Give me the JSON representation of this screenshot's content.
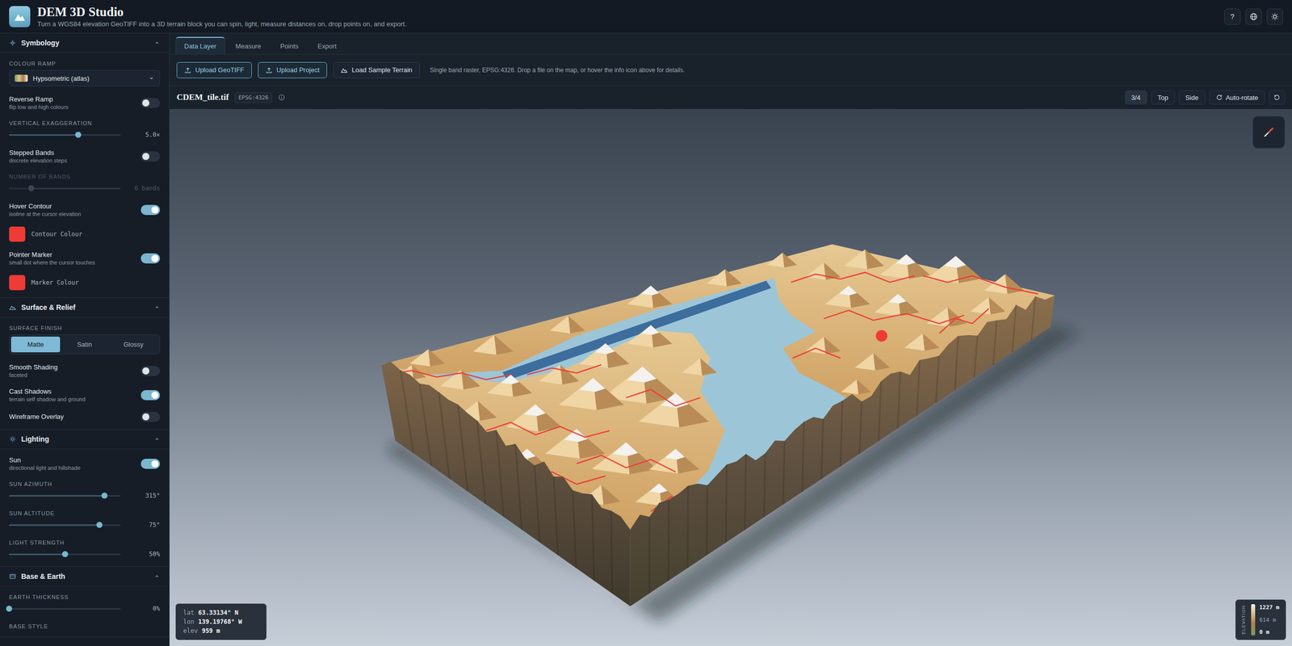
{
  "header": {
    "title": "DEM 3D Studio",
    "subtitle": "Turn a WGS84 elevation GeoTIFF into a 3D terrain block you can spin, light, measure distances on, drop points on, and export.",
    "help": "?"
  },
  "sidebar": {
    "sections": [
      {
        "title": "Symbology",
        "expanded": true,
        "controls": [
          {
            "kind": "select",
            "label": "COLOUR RAMP",
            "value": "Hypsometric (atlas)"
          },
          {
            "kind": "toggle",
            "label": "Reverse Ramp",
            "hint": "flip low and high colours",
            "on": false
          },
          {
            "kind": "slider",
            "label": "VERTICAL EXAGGERATION",
            "level": 0.62,
            "reading": "5.0×",
            "disabled": false
          },
          {
            "kind": "toggle",
            "label": "Stepped Bands",
            "hint": "discrete elevation steps",
            "on": false
          },
          {
            "kind": "slider",
            "label": "NUMBER OF BANDS",
            "level": 0.2,
            "reading": "6 bands",
            "disabled": true
          },
          {
            "kind": "toggle",
            "label": "Hover Contour",
            "hint": "isoline at the cursor elevation",
            "on": true
          },
          {
            "kind": "color",
            "label": "Contour Colour",
            "color": "#ef3b35"
          },
          {
            "kind": "toggle",
            "label": "Pointer Marker",
            "hint": "small dot where the cursor touches",
            "on": true
          },
          {
            "kind": "color",
            "label": "Marker Colour",
            "color": "#ef3b35"
          }
        ]
      },
      {
        "title": "Surface & Relief",
        "expanded": true,
        "controls": [
          {
            "kind": "segmented",
            "label": "SURFACE FINISH",
            "options": [
              {
                "label": "Matte",
                "selected": true
              },
              {
                "label": "Satin",
                "selected": false
              },
              {
                "label": "Glossy",
                "selected": false
              }
            ]
          },
          {
            "kind": "toggle",
            "label": "Smooth Shading",
            "hint": "faceted",
            "on": false
          },
          {
            "kind": "toggle",
            "label": "Cast Shadows",
            "hint": "terrain self shadow and ground",
            "on": true
          },
          {
            "kind": "toggle",
            "label": "Wireframe Overlay",
            "hint": "",
            "on": false
          }
        ]
      },
      {
        "title": "Lighting",
        "expanded": true,
        "controls": [
          {
            "kind": "toggle",
            "label": "Sun",
            "hint": "directional light and hillshade",
            "on": true
          },
          {
            "kind": "slider",
            "label": "SUN AZIMUTH",
            "level": 0.855,
            "reading": "315°",
            "disabled": false
          },
          {
            "kind": "slider",
            "label": "SUN ALTITUDE",
            "level": 0.81,
            "reading": "75°",
            "disabled": false
          },
          {
            "kind": "slider",
            "label": "LIGHT STRENGTH",
            "level": 0.5,
            "reading": "50%",
            "disabled": false
          }
        ]
      },
      {
        "title": "Base & Earth",
        "expanded": true,
        "controls": [
          {
            "kind": "slider",
            "label": "EARTH THICKNESS",
            "level": 0.0,
            "reading": "0%",
            "disabled": false
          },
          {
            "kind": "label",
            "label": "BASE STYLE"
          }
        ]
      }
    ]
  },
  "tabs": [
    {
      "label": "Data Layer",
      "selected": true
    },
    {
      "label": "Measure",
      "selected": false
    },
    {
      "label": "Points",
      "selected": false
    },
    {
      "label": "Export",
      "selected": false
    }
  ],
  "toolbar": {
    "buttons": [
      {
        "label": "Upload GeoTIFF",
        "kind": "upload"
      },
      {
        "label": "Upload Project",
        "kind": "upload"
      },
      {
        "label": "Load Sample Terrain",
        "kind": "sample"
      }
    ],
    "hint": "Single band raster, EPSG:4326. Drop a file on the map, or hover the info icon above for details."
  },
  "file": {
    "name": "CDEM_tile.tif",
    "crs": "EPSG:4326",
    "views": [
      {
        "label": "3/4",
        "selected": true
      },
      {
        "label": "Top",
        "selected": false
      },
      {
        "label": "Side",
        "selected": false
      }
    ],
    "auto_rotate": {
      "label": "Auto-rotate",
      "on": false
    }
  },
  "readout": [
    {
      "key": "lat",
      "value": "63.33134° N"
    },
    {
      "key": "lon",
      "value": "139.19768° W"
    },
    {
      "key": "elev",
      "value": "959 m"
    }
  ],
  "legend": {
    "title": "ELEVATION",
    "ticks": [
      "1227 m",
      "614 m",
      "0 m"
    ]
  }
}
